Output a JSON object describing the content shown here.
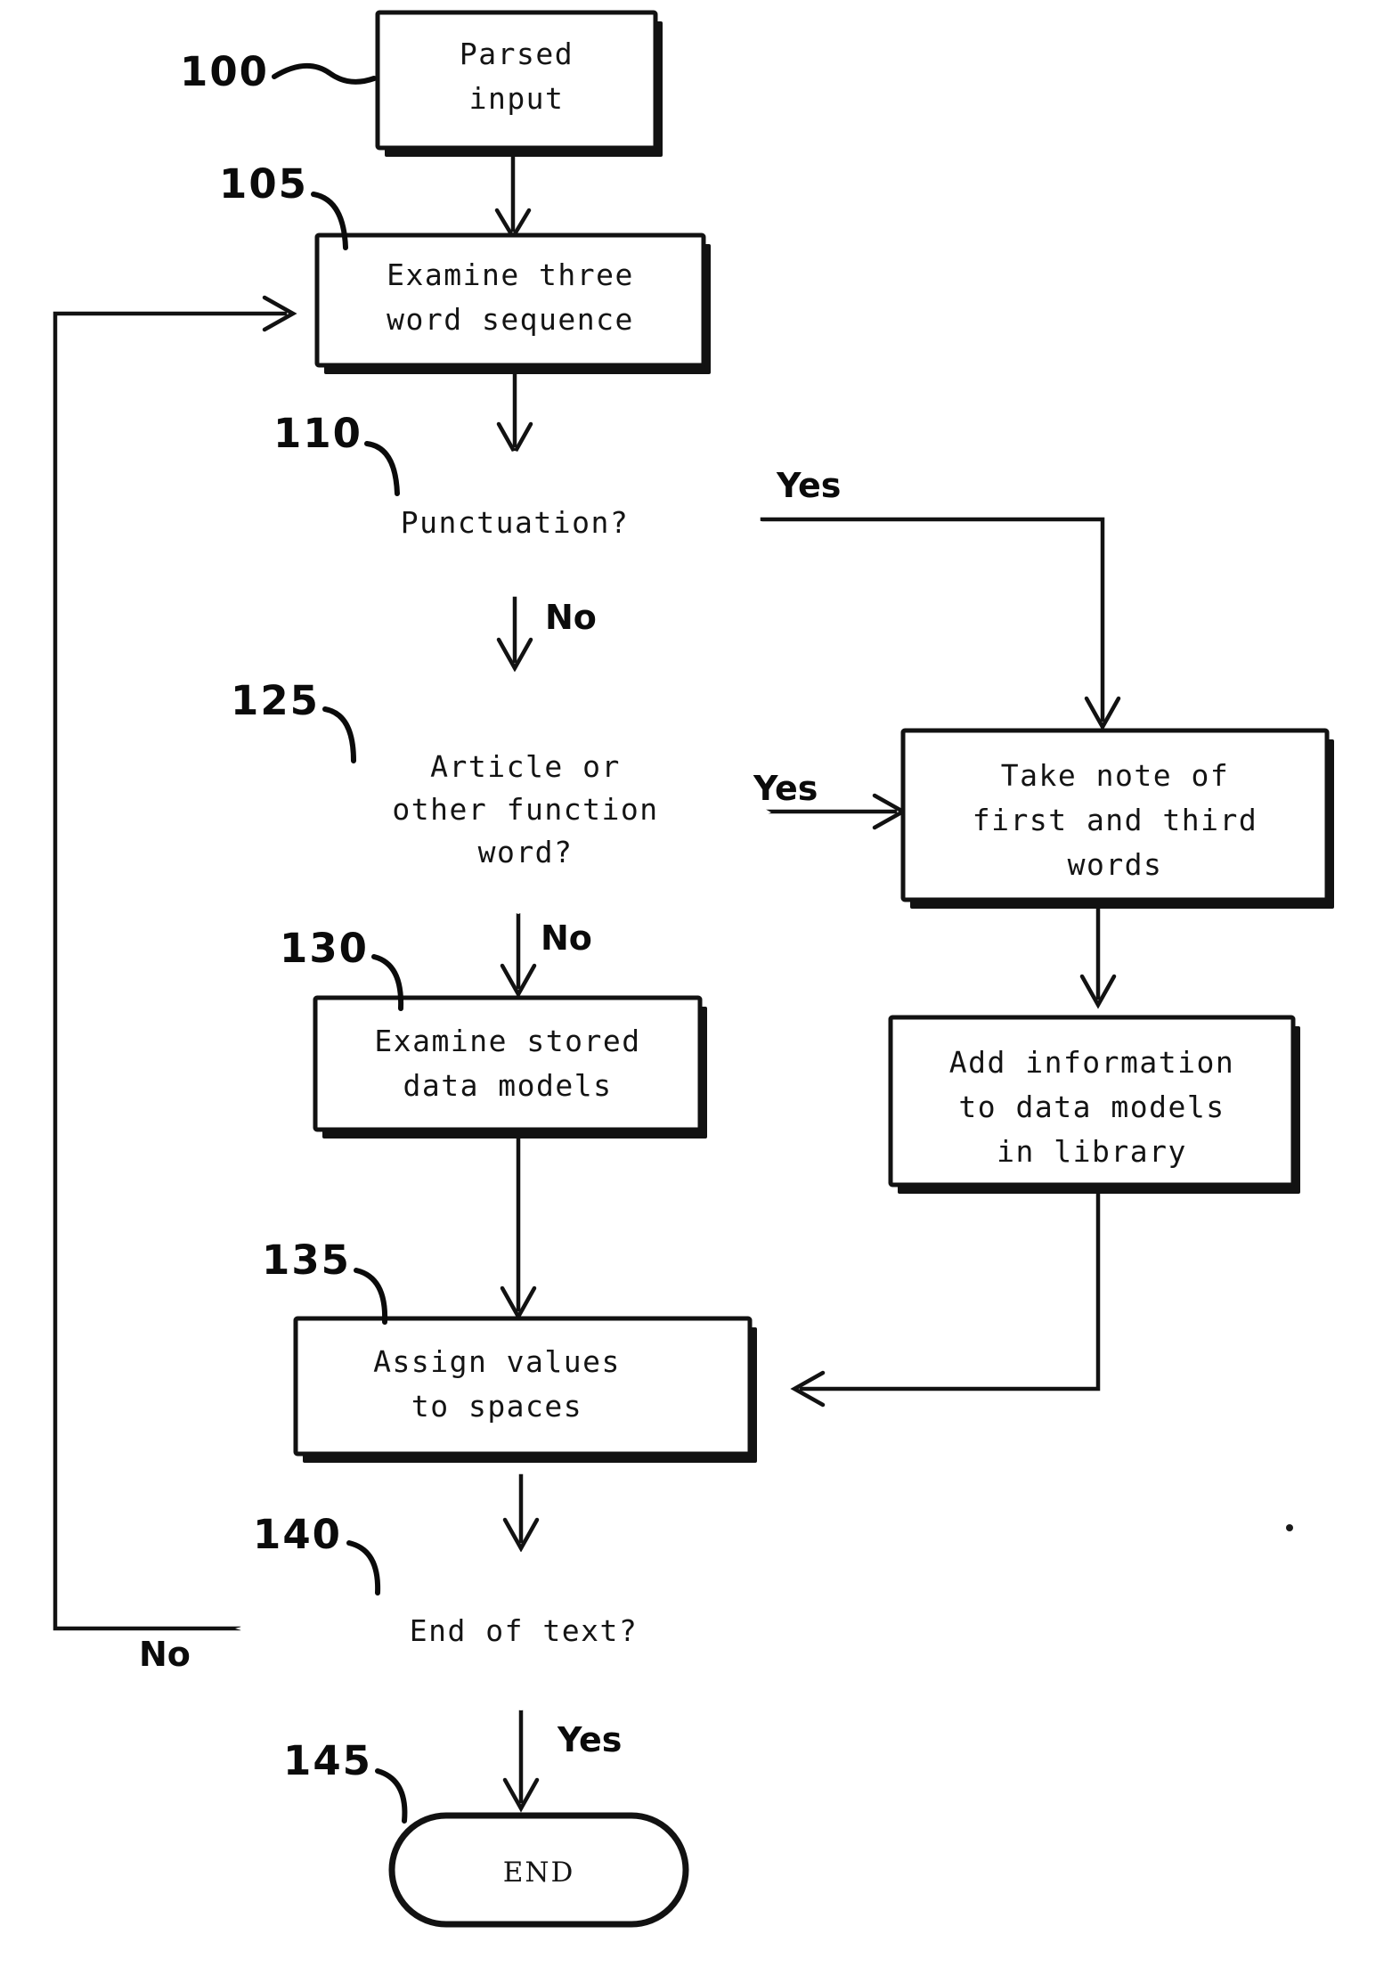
{
  "figure": {
    "type": "patent-flowchart",
    "background": "#ffffff",
    "ink": "#121212"
  },
  "nodes": {
    "start": {
      "ref": "100",
      "shape": "process",
      "lines": [
        "Parsed",
        "input"
      ]
    },
    "examine_seq": {
      "ref": "105",
      "shape": "process",
      "lines": [
        "Examine three",
        "word sequence"
      ]
    },
    "punctuation": {
      "ref": "110",
      "shape": "decision",
      "lines": [
        "Punctuation?"
      ]
    },
    "article": {
      "ref": "125",
      "shape": "decision",
      "lines": [
        "Article or",
        "other function",
        "word?"
      ]
    },
    "take_note": {
      "ref": "",
      "shape": "process",
      "lines": [
        "Take note of",
        "first and third",
        "words"
      ]
    },
    "examine_models": {
      "ref": "130",
      "shape": "process",
      "lines": [
        "Examine stored",
        "data models"
      ]
    },
    "add_info": {
      "ref": "",
      "shape": "process",
      "lines": [
        "Add information",
        "to data models",
        "in library"
      ]
    },
    "assign_values": {
      "ref": "135",
      "shape": "process",
      "lines": [
        "Assign values",
        "to spaces"
      ]
    },
    "end_of_text": {
      "ref": "140",
      "shape": "decision",
      "lines": [
        "End of text?"
      ]
    },
    "end": {
      "ref": "145",
      "shape": "terminator",
      "lines": [
        "END"
      ]
    }
  },
  "branch_labels": {
    "punctuation_yes": "Yes",
    "punctuation_no": "No",
    "article_yes": "Yes",
    "article_no": "No",
    "end_of_text_no": "No",
    "end_of_text_yes": "Yes"
  },
  "reference_numerals": [
    "100",
    "105",
    "110",
    "125",
    "130",
    "135",
    "140",
    "145"
  ]
}
